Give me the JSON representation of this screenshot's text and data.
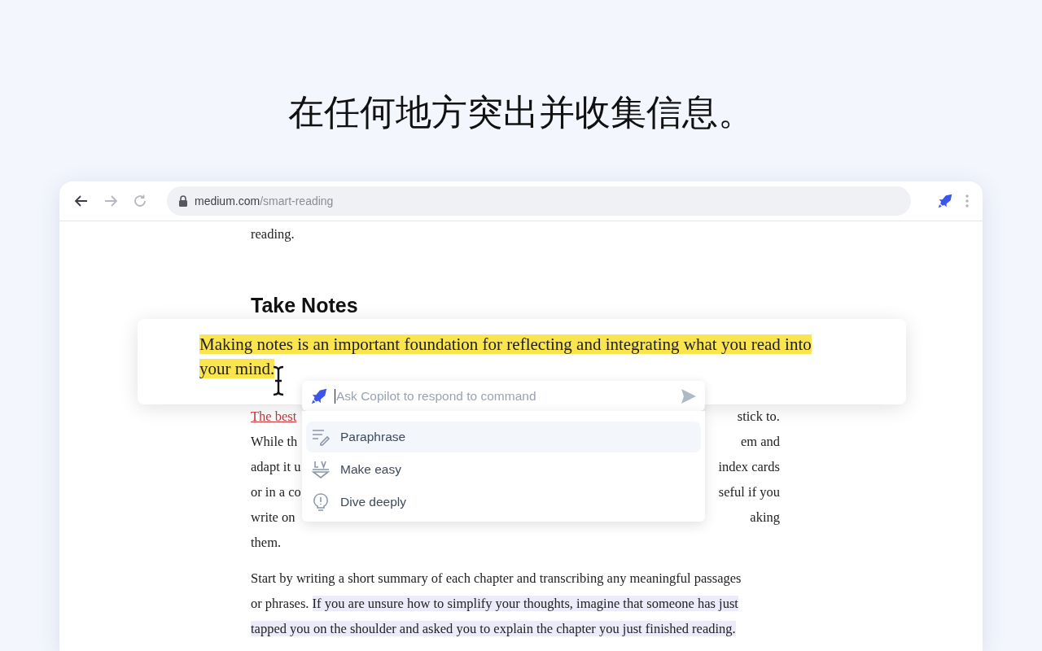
{
  "headline": "在任何地方突出并收集信息。",
  "browser": {
    "nav": [
      {
        "kind": "back",
        "disabled": false
      },
      {
        "kind": "forward",
        "disabled": true
      },
      {
        "kind": "reload",
        "disabled": true
      }
    ],
    "url": {
      "domain": "medium.com",
      "path": "/smart-reading"
    }
  },
  "article": {
    "top_line": "reading.",
    "heading": "Take Notes",
    "paragraph_1": [
      {
        "segments": [
          {
            "kind": "link",
            "text": "The best"
          }
        ],
        "right": "stick to."
      },
      {
        "segments": [
          {
            "kind": "plain",
            "text": "While th"
          }
        ],
        "right": "em and"
      },
      {
        "segments": [
          {
            "kind": "plain",
            "text": "adapt it u"
          }
        ],
        "right": "index cards"
      },
      {
        "segments": [
          {
            "kind": "plain",
            "text": "or in a co"
          }
        ],
        "right": "seful if you"
      },
      {
        "segments": [
          {
            "kind": "plain",
            "text": "write on"
          }
        ],
        "right": "aking"
      },
      {
        "segments": [
          {
            "kind": "plain",
            "text": "them."
          }
        ]
      }
    ],
    "paragraph_2": [
      {
        "segments": [
          {
            "kind": "plain",
            "text": "Start by writing a short summary of each chapter and transcribing any meaningful passages"
          }
        ]
      },
      {
        "segments": [
          {
            "kind": "plain",
            "text": "or phrases. "
          },
          {
            "kind": "highlight",
            "text": "If you are unsure how to simplify your thoughts, imagine that someone has just"
          }
        ]
      },
      {
        "segments": [
          {
            "kind": "highlight",
            "text": "tapped you on the shoulder and asked you to explain the chapter you just finished reading."
          }
        ]
      }
    ]
  },
  "highlight_card": {
    "text": "Making notes is an important foundation for reflecting and integrating what you read into your mind."
  },
  "copilot": {
    "placeholder": "Ask Copilot to respond to command",
    "commands": [
      {
        "kind": "paraphrase",
        "label": "Paraphrase",
        "selected": true
      },
      {
        "kind": "simplify",
        "label": "Make easy",
        "selected": false
      },
      {
        "kind": "explain",
        "label": "Dive deeply",
        "selected": false
      }
    ]
  }
}
